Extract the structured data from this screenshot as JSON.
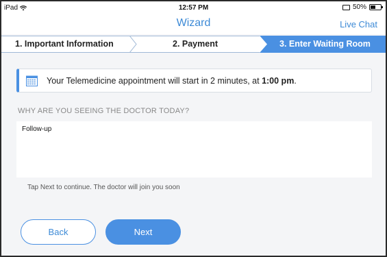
{
  "status_bar": {
    "device": "iPad",
    "time": "12:57 PM",
    "battery": "50%",
    "battery_level": 0.5
  },
  "nav": {
    "title": "Wizard",
    "live_chat": "Live Chat"
  },
  "steps": [
    {
      "label": "1. Important Information",
      "active": false
    },
    {
      "label": "2. Payment",
      "active": false
    },
    {
      "label": "3. Enter Waiting Room",
      "active": true
    }
  ],
  "banner": {
    "text": "Your Telemedicine appointment will start in 2 minutes, at ",
    "time": "1:00 pm",
    "suffix": ".",
    "icon": "calendar-icon"
  },
  "question": {
    "label": "WHY ARE YOU SEEING THE DOCTOR TODAY?",
    "value": "Follow-up"
  },
  "hint": "Tap Next to continue. The doctor will join you soon",
  "buttons": {
    "back": "Back",
    "next": "Next"
  },
  "colors": {
    "accent": "#4a90e2",
    "background": "#f4f5f7"
  }
}
